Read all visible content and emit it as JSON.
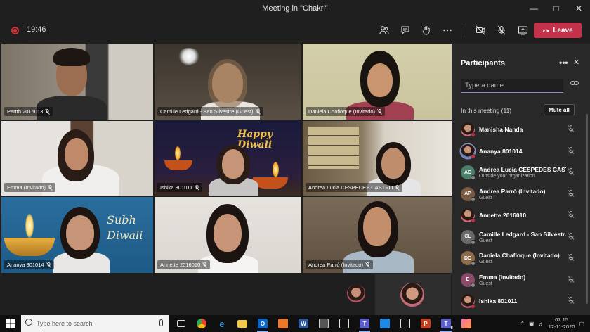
{
  "window": {
    "title": "Meeting in \"Chakri\""
  },
  "toolbar": {
    "timer": "19:46",
    "leave_label": "Leave"
  },
  "tiles": [
    {
      "name": "Partth 2016013"
    },
    {
      "name": "Camille Ledgard - San Silvestre (Guest)"
    },
    {
      "name": "Daniela Chafloque (Invitado)"
    },
    {
      "name": "Emma (Invitado)"
    },
    {
      "name": "Ishika 801011",
      "overlay_text": "Happy Diwali"
    },
    {
      "name": "Andrea Lucia CESPEDES CASTRO"
    },
    {
      "name": "Ananya 801014",
      "overlay_text": "Subh Diwali"
    },
    {
      "name": "Annette 2016010"
    },
    {
      "name": "Andrea Parrò (Invitado)"
    }
  ],
  "panel": {
    "title": "Participants",
    "search_placeholder": "Type a name",
    "section_label": "In this meeting (11)",
    "mute_all_label": "Mute all",
    "participants": [
      {
        "name": "Manisha Nanda",
        "initials": "",
        "sub": ""
      },
      {
        "name": "Ananya 801014",
        "initials": "",
        "sub": ""
      },
      {
        "name": "Andrea Lucia CESPEDES CAST...",
        "initials": "AC",
        "sub": "Outside your organization"
      },
      {
        "name": "Andrea Parrò (Invitado)",
        "initials": "AP",
        "sub": "Guest"
      },
      {
        "name": "Annette 2016010",
        "initials": "",
        "sub": ""
      },
      {
        "name": "Camille Ledgard - San Silvestr...",
        "initials": "CL",
        "sub": "Guest"
      },
      {
        "name": "Daniela Chafloque (Invitado)",
        "initials": "DC",
        "sub": "Guest"
      },
      {
        "name": "Emma (Invitado)",
        "initials": "E",
        "sub": "Guest"
      },
      {
        "name": "Ishika 801011",
        "initials": "",
        "sub": ""
      }
    ]
  },
  "taskbar": {
    "search_placeholder": "Type here to search",
    "time": "07:15",
    "date": "12-11-2020",
    "teams_badge": "6"
  },
  "colors": {
    "accent": "#6264a7",
    "leave": "#c4314b",
    "status_away": "#c4314b"
  }
}
